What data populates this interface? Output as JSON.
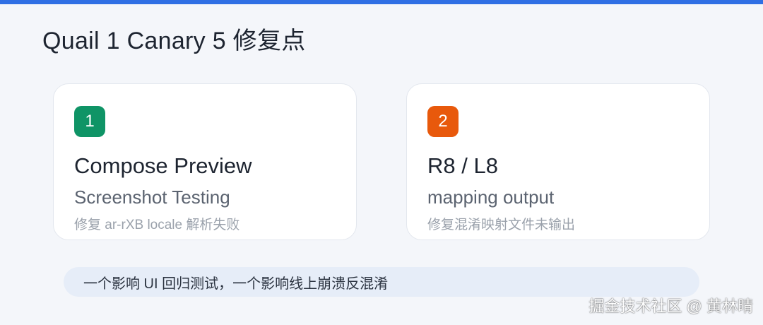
{
  "page": {
    "title": "Quail 1 Canary 5 修复点",
    "accent_color": "#2f6fe4"
  },
  "cards": [
    {
      "number": "1",
      "badge_color": "#0f9466",
      "title": "Compose Preview",
      "subtitle": "Screenshot Testing",
      "description": "修复 ar-rXB locale 解析失败"
    },
    {
      "number": "2",
      "badge_color": "#e8590c",
      "title": "R8 / L8",
      "subtitle": "mapping output",
      "description": "修复混淆映射文件未输出"
    }
  ],
  "summary": {
    "text": "一个影响 UI 回归测试，一个影响线上崩溃反混淆"
  },
  "watermark": {
    "text": "掘金技术社区 @ 黄林晴"
  }
}
